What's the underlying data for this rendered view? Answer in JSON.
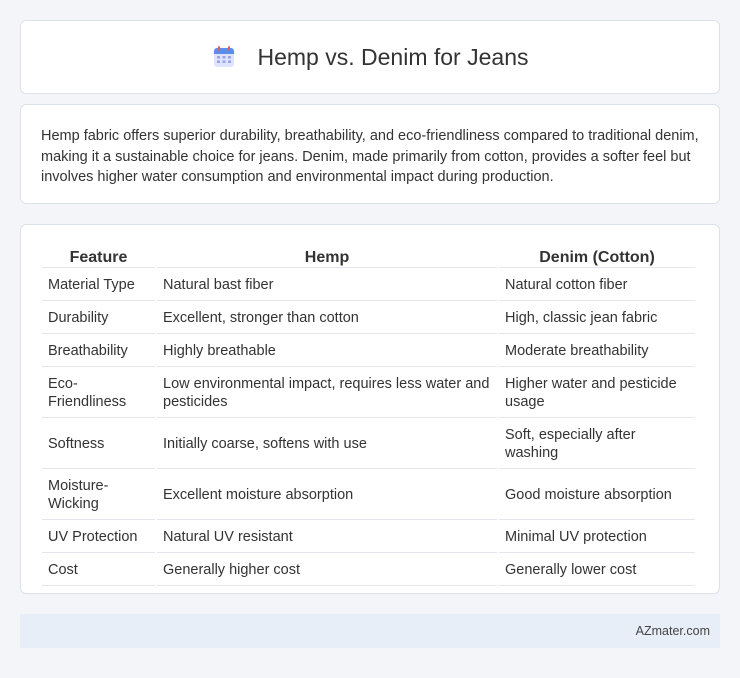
{
  "header": {
    "title": "Hemp vs. Denim for Jeans",
    "icon": "calendar-icon",
    "icon_colors": {
      "body": "#dfe3ff",
      "top": "#5b8def",
      "grid": "#9aa3e6"
    }
  },
  "intro": {
    "text": "Hemp fabric offers superior durability, breathability, and eco-friendliness compared to traditional denim, making it a sustainable choice for jeans. Denim, made primarily from cotton, provides a softer feel but involves higher water consumption and environmental impact during production."
  },
  "table": {
    "headers": [
      "Feature",
      "Hemp",
      "Denim (Cotton)"
    ],
    "rows": [
      [
        "Material Type",
        "Natural bast fiber",
        "Natural cotton fiber"
      ],
      [
        "Durability",
        "Excellent, stronger than cotton",
        "High, classic jean fabric"
      ],
      [
        "Breathability",
        "Highly breathable",
        "Moderate breathability"
      ],
      [
        "Eco-Friendliness",
        "Low environmental impact, requires less water and pesticides",
        "Higher water and pesticide usage"
      ],
      [
        "Softness",
        "Initially coarse, softens with use",
        "Soft, especially after washing"
      ],
      [
        "Moisture-Wicking",
        "Excellent moisture absorption",
        "Good moisture absorption"
      ],
      [
        "UV Protection",
        "Natural UV resistant",
        "Minimal UV protection"
      ],
      [
        "Cost",
        "Generally higher cost",
        "Generally lower cost"
      ]
    ]
  },
  "footer": {
    "site": "AZmater.com"
  }
}
